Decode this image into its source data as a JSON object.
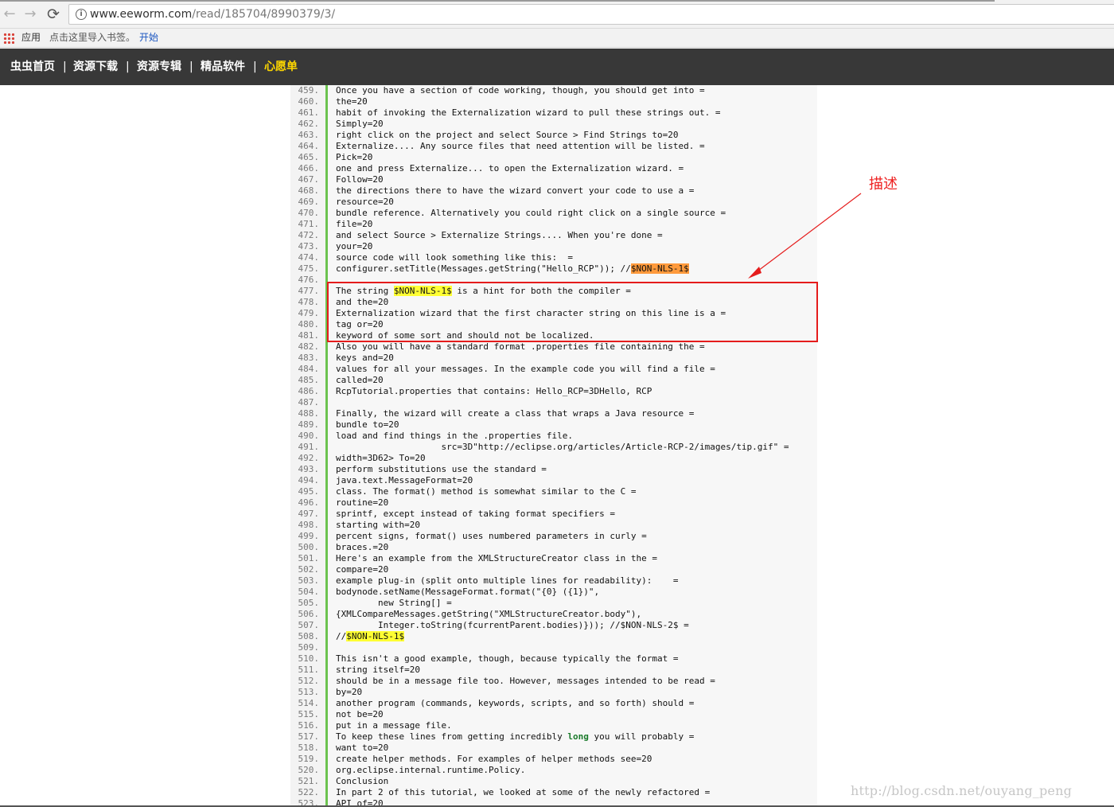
{
  "browser": {
    "back_glyph": "←",
    "forward_glyph": "→",
    "reload_glyph": "⟳",
    "url_host": "www.eeworm.com",
    "url_path": "/read/185704/8990379/3/",
    "bookmarks": {
      "apps_label": "应用",
      "hint": "点击这里导入书签。",
      "start_link": "开始"
    }
  },
  "site_nav": {
    "items": [
      {
        "label": "虫虫首页"
      },
      {
        "label": "资源下载"
      },
      {
        "label": "资源专辑"
      },
      {
        "label": "精品软件"
      },
      {
        "label": "心愿单",
        "active": true
      }
    ],
    "separator": "|"
  },
  "code_lines": [
    {
      "n": "459.",
      "t": "Once you have a section of code working, though, you should get into ="
    },
    {
      "n": "460.",
      "t": "the=20"
    },
    {
      "n": "461.",
      "t": "habit of invoking the Externalization wizard to pull these strings out. ="
    },
    {
      "n": "462.",
      "t": "Simply=20"
    },
    {
      "n": "463.",
      "t": "right click on the project and select Source > Find Strings to=20"
    },
    {
      "n": "464.",
      "t": "Externalize.... Any source files that need attention will be listed. ="
    },
    {
      "n": "465.",
      "t": "Pick=20"
    },
    {
      "n": "466.",
      "t": "one and press Externalize... to open the Externalization wizard. ="
    },
    {
      "n": "467.",
      "t": "Follow=20"
    },
    {
      "n": "468.",
      "t": "the directions there to have the wizard convert your code to use a ="
    },
    {
      "n": "469.",
      "t": "resource=20"
    },
    {
      "n": "470.",
      "t": "bundle reference. Alternatively you could right click on a single source ="
    },
    {
      "n": "471.",
      "t": "file=20"
    },
    {
      "n": "472.",
      "t": "and select Source > Externalize Strings.... When you're done ="
    },
    {
      "n": "473.",
      "t": "your=20"
    },
    {
      "n": "474.",
      "t": "source code will look something like this:  ="
    },
    {
      "n": "475.",
      "t": "configurer.setTitle(Messages.getString(\"Hello_RCP\")); //",
      "hl": "$NON-NLS-1$",
      "hl_color": "orange"
    },
    {
      "n": "476.",
      "t": ""
    },
    {
      "n": "477.",
      "t": "The string ",
      "hl": "$NON-NLS-1$",
      "hl_color": "yellow",
      "after": " is a hint for both the compiler ="
    },
    {
      "n": "478.",
      "t": "and the=20"
    },
    {
      "n": "479.",
      "t": "Externalization wizard that the first character string on this line is a ="
    },
    {
      "n": "480.",
      "t": "tag or=20"
    },
    {
      "n": "481.",
      "t": "keyword of some sort and should not be localized."
    },
    {
      "n": "482.",
      "t": "Also you will have a standard format .properties file containing the ="
    },
    {
      "n": "483.",
      "t": "keys and=20"
    },
    {
      "n": "484.",
      "t": "values for all your messages. In the example code you will find a file ="
    },
    {
      "n": "485.",
      "t": "called=20"
    },
    {
      "n": "486.",
      "t": "RcpTutorial.properties that contains: Hello_RCP=3DHello, RCP"
    },
    {
      "n": "487.",
      "t": ""
    },
    {
      "n": "488.",
      "t": "Finally, the wizard will create a class that wraps a Java resource ="
    },
    {
      "n": "489.",
      "t": "bundle to=20"
    },
    {
      "n": "490.",
      "t": "load and find things in the .properties file."
    },
    {
      "n": "491.",
      "t": "                    src=3D\"http://eclipse.org/articles/Article-RCP-2/images/tip.gif\" ="
    },
    {
      "n": "492.",
      "t": "width=3D62> To=20"
    },
    {
      "n": "493.",
      "t": "perform substitutions use the standard ="
    },
    {
      "n": "494.",
      "t": "java.text.MessageFormat=20"
    },
    {
      "n": "495.",
      "t": "class. The format() method is somewhat similar to the C ="
    },
    {
      "n": "496.",
      "t": "routine=20"
    },
    {
      "n": "497.",
      "t": "sprintf, except instead of taking format specifiers ="
    },
    {
      "n": "498.",
      "t": "starting with=20"
    },
    {
      "n": "499.",
      "t": "percent signs, format() uses numbered parameters in curly ="
    },
    {
      "n": "500.",
      "t": "braces.=20"
    },
    {
      "n": "501.",
      "t": "Here's an example from the XMLStructureCreator class in the ="
    },
    {
      "n": "502.",
      "t": "compare=20"
    },
    {
      "n": "503.",
      "t": "example plug-in (split onto multiple lines for readability):    ="
    },
    {
      "n": "504.",
      "t": "bodynode.setName(MessageFormat.format(\"{0} ({1})\","
    },
    {
      "n": "505.",
      "t": "        new String[] ="
    },
    {
      "n": "506.",
      "t": "{XMLCompareMessages.getString(\"XMLStructureCreator.body\"),"
    },
    {
      "n": "507.",
      "t": "        Integer.toString(fcurrentParent.bodies)})); //$NON-NLS-2$ ="
    },
    {
      "n": "508.",
      "t": "//",
      "hl": "$NON-NLS-1$",
      "hl_color": "yellow"
    },
    {
      "n": "509.",
      "t": ""
    },
    {
      "n": "510.",
      "t": "This isn't a good example, though, because typically the format ="
    },
    {
      "n": "511.",
      "t": "string itself=20"
    },
    {
      "n": "512.",
      "t": "should be in a message file too. However, messages intended to be read ="
    },
    {
      "n": "513.",
      "t": "by=20"
    },
    {
      "n": "514.",
      "t": "another program (commands, keywords, scripts, and so forth) should ="
    },
    {
      "n": "515.",
      "t": "not be=20"
    },
    {
      "n": "516.",
      "t": "put in a message file."
    },
    {
      "n": "517.",
      "t": "To keep these lines from getting incredibly ",
      "kw": "long",
      "after": " you will probably ="
    },
    {
      "n": "518.",
      "t": "want to=20"
    },
    {
      "n": "519.",
      "t": "create helper methods. For examples of helper methods see=20"
    },
    {
      "n": "520.",
      "t": "org.eclipse.internal.runtime.Policy."
    },
    {
      "n": "521.",
      "t": "Conclusion"
    },
    {
      "n": "522.",
      "t": "In part 2 of this tutorial, we looked at some of the newly refactored ="
    },
    {
      "n": "523.",
      "t": "API of=20"
    }
  ],
  "annotation": {
    "label": "描述",
    "color": "#e51c1c"
  },
  "watermark": "http://blog.csdn.net/ouyang_peng",
  "colors": {
    "nav_bg": "#383838",
    "nav_active": "#ffd800",
    "gutter_line": "#6cc34f",
    "highlight_yellow": "#ffff33",
    "highlight_orange": "#ff9a3c"
  }
}
